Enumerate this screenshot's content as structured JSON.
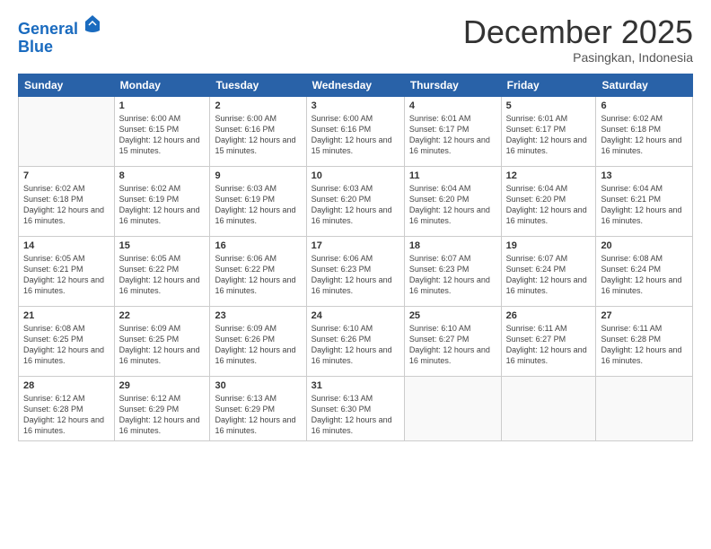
{
  "logo": {
    "line1": "General",
    "line2": "Blue"
  },
  "title": "December 2025",
  "location": "Pasingkan, Indonesia",
  "weekdays": [
    "Sunday",
    "Monday",
    "Tuesday",
    "Wednesday",
    "Thursday",
    "Friday",
    "Saturday"
  ],
  "weeks": [
    [
      {
        "day": null
      },
      {
        "day": "1",
        "sunrise": "6:00 AM",
        "sunset": "6:15 PM",
        "daylight": "12 hours and 15 minutes."
      },
      {
        "day": "2",
        "sunrise": "6:00 AM",
        "sunset": "6:16 PM",
        "daylight": "12 hours and 15 minutes."
      },
      {
        "day": "3",
        "sunrise": "6:00 AM",
        "sunset": "6:16 PM",
        "daylight": "12 hours and 15 minutes."
      },
      {
        "day": "4",
        "sunrise": "6:01 AM",
        "sunset": "6:17 PM",
        "daylight": "12 hours and 16 minutes."
      },
      {
        "day": "5",
        "sunrise": "6:01 AM",
        "sunset": "6:17 PM",
        "daylight": "12 hours and 16 minutes."
      },
      {
        "day": "6",
        "sunrise": "6:02 AM",
        "sunset": "6:18 PM",
        "daylight": "12 hours and 16 minutes."
      }
    ],
    [
      {
        "day": "7",
        "sunrise": "6:02 AM",
        "sunset": "6:18 PM",
        "daylight": "12 hours and 16 minutes."
      },
      {
        "day": "8",
        "sunrise": "6:02 AM",
        "sunset": "6:19 PM",
        "daylight": "12 hours and 16 minutes."
      },
      {
        "day": "9",
        "sunrise": "6:03 AM",
        "sunset": "6:19 PM",
        "daylight": "12 hours and 16 minutes."
      },
      {
        "day": "10",
        "sunrise": "6:03 AM",
        "sunset": "6:20 PM",
        "daylight": "12 hours and 16 minutes."
      },
      {
        "day": "11",
        "sunrise": "6:04 AM",
        "sunset": "6:20 PM",
        "daylight": "12 hours and 16 minutes."
      },
      {
        "day": "12",
        "sunrise": "6:04 AM",
        "sunset": "6:20 PM",
        "daylight": "12 hours and 16 minutes."
      },
      {
        "day": "13",
        "sunrise": "6:04 AM",
        "sunset": "6:21 PM",
        "daylight": "12 hours and 16 minutes."
      }
    ],
    [
      {
        "day": "14",
        "sunrise": "6:05 AM",
        "sunset": "6:21 PM",
        "daylight": "12 hours and 16 minutes."
      },
      {
        "day": "15",
        "sunrise": "6:05 AM",
        "sunset": "6:22 PM",
        "daylight": "12 hours and 16 minutes."
      },
      {
        "day": "16",
        "sunrise": "6:06 AM",
        "sunset": "6:22 PM",
        "daylight": "12 hours and 16 minutes."
      },
      {
        "day": "17",
        "sunrise": "6:06 AM",
        "sunset": "6:23 PM",
        "daylight": "12 hours and 16 minutes."
      },
      {
        "day": "18",
        "sunrise": "6:07 AM",
        "sunset": "6:23 PM",
        "daylight": "12 hours and 16 minutes."
      },
      {
        "day": "19",
        "sunrise": "6:07 AM",
        "sunset": "6:24 PM",
        "daylight": "12 hours and 16 minutes."
      },
      {
        "day": "20",
        "sunrise": "6:08 AM",
        "sunset": "6:24 PM",
        "daylight": "12 hours and 16 minutes."
      }
    ],
    [
      {
        "day": "21",
        "sunrise": "6:08 AM",
        "sunset": "6:25 PM",
        "daylight": "12 hours and 16 minutes."
      },
      {
        "day": "22",
        "sunrise": "6:09 AM",
        "sunset": "6:25 PM",
        "daylight": "12 hours and 16 minutes."
      },
      {
        "day": "23",
        "sunrise": "6:09 AM",
        "sunset": "6:26 PM",
        "daylight": "12 hours and 16 minutes."
      },
      {
        "day": "24",
        "sunrise": "6:10 AM",
        "sunset": "6:26 PM",
        "daylight": "12 hours and 16 minutes."
      },
      {
        "day": "25",
        "sunrise": "6:10 AM",
        "sunset": "6:27 PM",
        "daylight": "12 hours and 16 minutes."
      },
      {
        "day": "26",
        "sunrise": "6:11 AM",
        "sunset": "6:27 PM",
        "daylight": "12 hours and 16 minutes."
      },
      {
        "day": "27",
        "sunrise": "6:11 AM",
        "sunset": "6:28 PM",
        "daylight": "12 hours and 16 minutes."
      }
    ],
    [
      {
        "day": "28",
        "sunrise": "6:12 AM",
        "sunset": "6:28 PM",
        "daylight": "12 hours and 16 minutes."
      },
      {
        "day": "29",
        "sunrise": "6:12 AM",
        "sunset": "6:29 PM",
        "daylight": "12 hours and 16 minutes."
      },
      {
        "day": "30",
        "sunrise": "6:13 AM",
        "sunset": "6:29 PM",
        "daylight": "12 hours and 16 minutes."
      },
      {
        "day": "31",
        "sunrise": "6:13 AM",
        "sunset": "6:30 PM",
        "daylight": "12 hours and 16 minutes."
      },
      {
        "day": null
      },
      {
        "day": null
      },
      {
        "day": null
      }
    ]
  ]
}
